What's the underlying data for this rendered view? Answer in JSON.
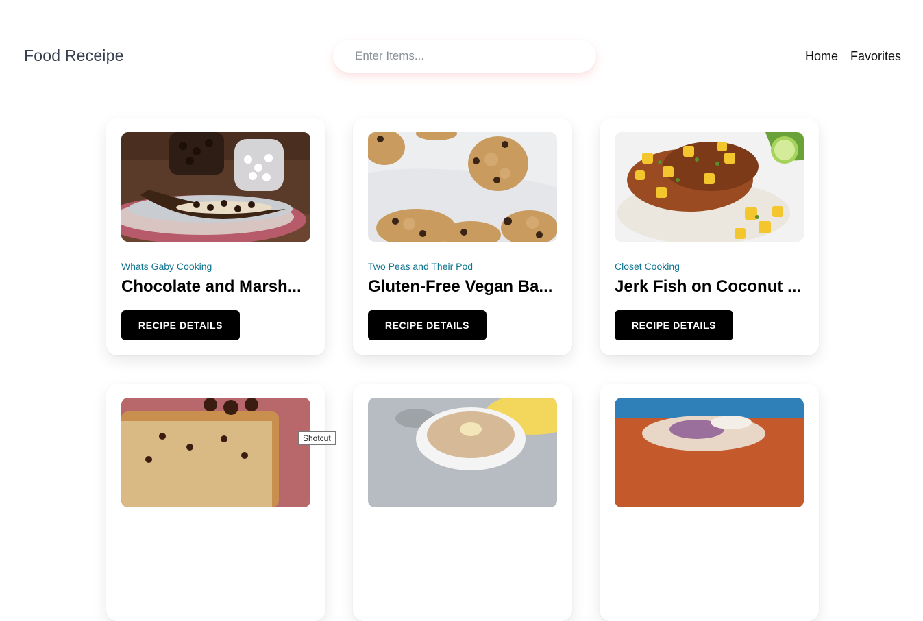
{
  "header": {
    "brand": "Food Receipe",
    "search": {
      "placeholder": "Enter Items...",
      "value": ""
    },
    "nav": [
      {
        "label": "Home"
      },
      {
        "label": "Favorites"
      }
    ]
  },
  "recipes": [
    {
      "publisher": "Whats Gaby Cooking",
      "title": "Chocolate and Marsh...",
      "button_label": "RECIPE DETAILS",
      "image": "roasted banana with chocolate chips and marshmallows"
    },
    {
      "publisher": "Two Peas and Their Pod",
      "title": "Gluten-Free Vegan Ba...",
      "button_label": "RECIPE DETAILS",
      "image": "banana oat chocolate chip cookies"
    },
    {
      "publisher": "Closet Cooking",
      "title": "Jerk Fish on Coconut ...",
      "button_label": "RECIPE DETAILS",
      "image": "jerk fish with pineapple salsa on coconut rice"
    },
    {
      "image": "chocolate banana bread slice"
    },
    {
      "image": "banana ice cream with scoop"
    },
    {
      "image": "sandwich with sauce"
    }
  ],
  "tooltip": "Shotcut",
  "colors": {
    "publisher": "#0e7490",
    "button_bg": "#000000",
    "brand": "#374151"
  }
}
